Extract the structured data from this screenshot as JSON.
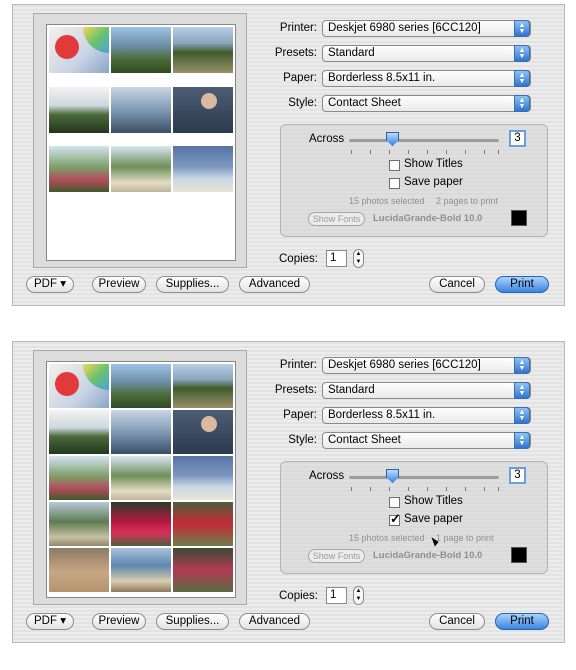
{
  "dialogs": [
    {
      "printer": {
        "label": "Printer:",
        "value": "Deskjet 6980 series [6CC120]"
      },
      "presets": {
        "label": "Presets:",
        "value": "Standard"
      },
      "paper": {
        "label": "Paper:",
        "value": "Borderless 8.5x11 in."
      },
      "style": {
        "label": "Style:",
        "value": "Contact Sheet"
      },
      "across": {
        "label": "Across",
        "value": "3",
        "slider_fraction": 0.25
      },
      "show_titles": {
        "label": "Show Titles",
        "checked": false
      },
      "save_paper": {
        "label": "Save paper",
        "checked": false
      },
      "photos_selected": "15 photos selected",
      "pages_to_print": "2 pages to print",
      "show_fonts": "Show Fonts",
      "font_name": "LucidaGrande-Bold 10.0",
      "copies": {
        "label": "Copies:",
        "value": "1"
      },
      "buttons": {
        "pdf": "PDF ▾",
        "preview": "Preview",
        "supplies": "Supplies...",
        "advanced": "Advanced",
        "cancel": "Cancel",
        "print": "Print"
      }
    },
    {
      "printer": {
        "label": "Printer:",
        "value": "Deskjet 6980 series [6CC120]"
      },
      "presets": {
        "label": "Presets:",
        "value": "Standard"
      },
      "paper": {
        "label": "Paper:",
        "value": "Borderless 8.5x11 in."
      },
      "style": {
        "label": "Style:",
        "value": "Contact Sheet"
      },
      "across": {
        "label": "Across",
        "value": "3",
        "slider_fraction": 0.25
      },
      "show_titles": {
        "label": "Show Titles",
        "checked": false
      },
      "save_paper": {
        "label": "Save paper",
        "checked": true
      },
      "photos_selected": "15 photos selected",
      "pages_to_print": "1 page to print",
      "show_fonts": "Show Fonts",
      "font_name": "LucidaGrande-Bold 10.0",
      "copies": {
        "label": "Copies:",
        "value": "1"
      },
      "buttons": {
        "pdf": "PDF ▾",
        "preview": "Preview",
        "supplies": "Supplies...",
        "advanced": "Advanced",
        "cancel": "Cancel",
        "print": "Print"
      }
    }
  ],
  "colors": {
    "accent": "#3a84e0",
    "window": "#e8e8e8"
  },
  "icons": {
    "popup_arrow": "double-chevron-icon",
    "stepper": "up-down-arrows-icon",
    "checkmark": "checkmark-icon"
  }
}
